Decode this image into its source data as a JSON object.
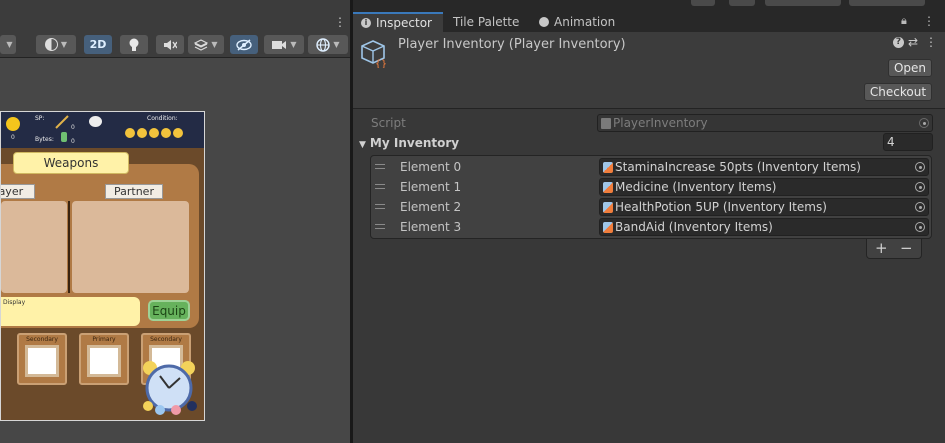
{
  "inspector": {
    "tabs": [
      {
        "label": "Inspector",
        "icon": "info-icon",
        "active": true
      },
      {
        "label": "Tile Palette",
        "active": false
      },
      {
        "label": "Animation",
        "icon": "animation-clock-icon",
        "active": false
      }
    ],
    "object_title": "Player Inventory (Player Inventory)",
    "open_button": "Open",
    "checkout_button": "Checkout",
    "script_label": "Script",
    "script_value": "PlayerInventory",
    "list_label": "My Inventory",
    "list_count": "4",
    "elements": [
      {
        "label": "Element 0",
        "value": "StaminaIncrease 50pts (Inventory Items)"
      },
      {
        "label": "Element 1",
        "value": "Medicine (Inventory Items)"
      },
      {
        "label": "Element 2",
        "value": "HealthPotion 5UP (Inventory Items)"
      },
      {
        "label": "Element 3",
        "value": "BandAid (Inventory Items)"
      }
    ],
    "add_button": "+",
    "remove_button": "−",
    "accent_color": "#3a79bb"
  },
  "scene": {
    "toolbar": {
      "mode_2d": "2D"
    },
    "game": {
      "hud": {
        "sp_label": "SP:",
        "bytes_label": "Bytes:",
        "condition_label": "Condition:",
        "coin_count": "0",
        "sp_value": "0",
        "bytes_value": "0"
      },
      "weapons_title": "Weapons",
      "player_label": "Player",
      "partner_label": "Partner",
      "display_text": "Display",
      "equip_button": "Equip",
      "slot_labels": [
        "Secondary",
        "Primary",
        "Secondary"
      ]
    }
  }
}
